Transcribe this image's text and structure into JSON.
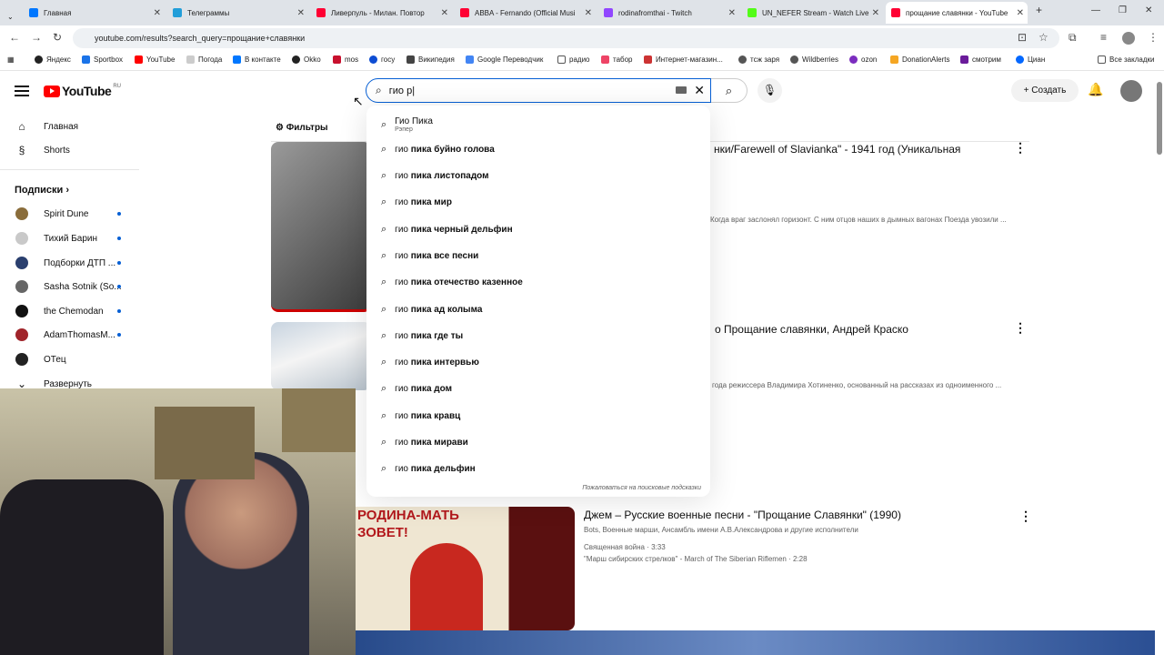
{
  "browser": {
    "tabs": [
      {
        "label": "Главная",
        "color": "#0077ff"
      },
      {
        "label": "Телеграммы",
        "color": "#229ed9"
      },
      {
        "label": "Ливерпуль - Милан. Повтор",
        "color": "#ff0033"
      },
      {
        "label": "ABBA - Fernando (Official Musi",
        "color": "#ff0033"
      },
      {
        "label": "rodinafromthai - Twitch",
        "color": "#9146ff"
      },
      {
        "label": "UN_NEFER Stream - Watch Live",
        "color": "#53fc18"
      },
      {
        "label": "прощание славянки - YouTube",
        "color": "#ff0033"
      }
    ],
    "url": "youtube.com/results?search_query=прощание+славянки",
    "bookmarks": [
      "Яндекс",
      "Sportbox",
      "YouTube",
      "Погода",
      "В контакте",
      "Okko",
      "mos",
      "госу",
      "Википедия",
      "Google Переводчик",
      "радио",
      "табор",
      "Интернет-магазин...",
      "тсж заря",
      "Wildberries",
      "ozon",
      "DonationAlerts",
      "смотрим",
      "Циан"
    ],
    "all_bookmarks": "Все закладки"
  },
  "header": {
    "logo_text": "YouTube",
    "region": "RU",
    "search_value": "гио р",
    "create_label": "Создать"
  },
  "sidebar": {
    "home": "Главная",
    "shorts": "Shorts",
    "subscriptions_title": "Подписки",
    "subscriptions": [
      {
        "name": "Spirit Dune",
        "color": "#8a6d3b"
      },
      {
        "name": "Тихий Барин",
        "color": "#c9c9c9"
      },
      {
        "name": "Подборки ДТП ...",
        "color": "#2a3f6e"
      },
      {
        "name": "Sasha Sotnik (So...",
        "color": "#666666"
      },
      {
        "name": "the Chemodan",
        "color": "#111111"
      },
      {
        "name": "AdamThomasM...",
        "color": "#a0242a"
      },
      {
        "name": "ОТец",
        "color": "#222222"
      }
    ],
    "expand": "Развернуть"
  },
  "main": {
    "filters_label": "Фильтры",
    "video1_title": "нки/Farewell of Slavianka\" - 1941 год (Уникальная",
    "video1_desc": "Когда враг заслонял горизонт. С ним отцов наших в дымных вагонах Поезда увозили ...",
    "video2_title": "о Прощание славянки, Андрей Краско",
    "video2_desc": "года режиссера Владимира Хотиненко, основанный на рассказах из одноименного ...",
    "video3_title": "Джем – Русские военные песни - \"Прощание Славянки\" (1990)",
    "video3_channel": "Bots, Военные марши, Ансамбль имени А.В.Александрова и другие исполнители",
    "video3_ch1": "Священная война · 3:33",
    "video3_ch2": "\"Марш сибирских стрелков\" - March of The Siberian Riflemen · 2:28",
    "poster_text": "РОДИНА-МАТЬ ЗОВЕТ!"
  },
  "suggestions": {
    "first": {
      "title": "Гио Пика",
      "sub": "Рэпер"
    },
    "items": [
      {
        "prefix": "гио ",
        "bold": "пика буйно голова"
      },
      {
        "prefix": "гио ",
        "bold": "пика листопадом"
      },
      {
        "prefix": "гио ",
        "bold": "пика мир"
      },
      {
        "prefix": "гио ",
        "bold": "пика черный дельфин"
      },
      {
        "prefix": "гио ",
        "bold": "пика все песни"
      },
      {
        "prefix": "гио ",
        "bold": "пика отечество казенное"
      },
      {
        "prefix": "гио ",
        "bold": "пика ад колыма"
      },
      {
        "prefix": "гио ",
        "bold": "пика где ты"
      },
      {
        "prefix": "гио ",
        "bold": "пика интервью"
      },
      {
        "prefix": "гио ",
        "bold": "пика дом"
      },
      {
        "prefix": "гио ",
        "bold": "пика кравц"
      },
      {
        "prefix": "гио ",
        "bold": "пика мирави"
      },
      {
        "prefix": "гио ",
        "bold": "пика дельфин"
      }
    ],
    "report": "Пожаловаться на поисковые подсказки"
  }
}
